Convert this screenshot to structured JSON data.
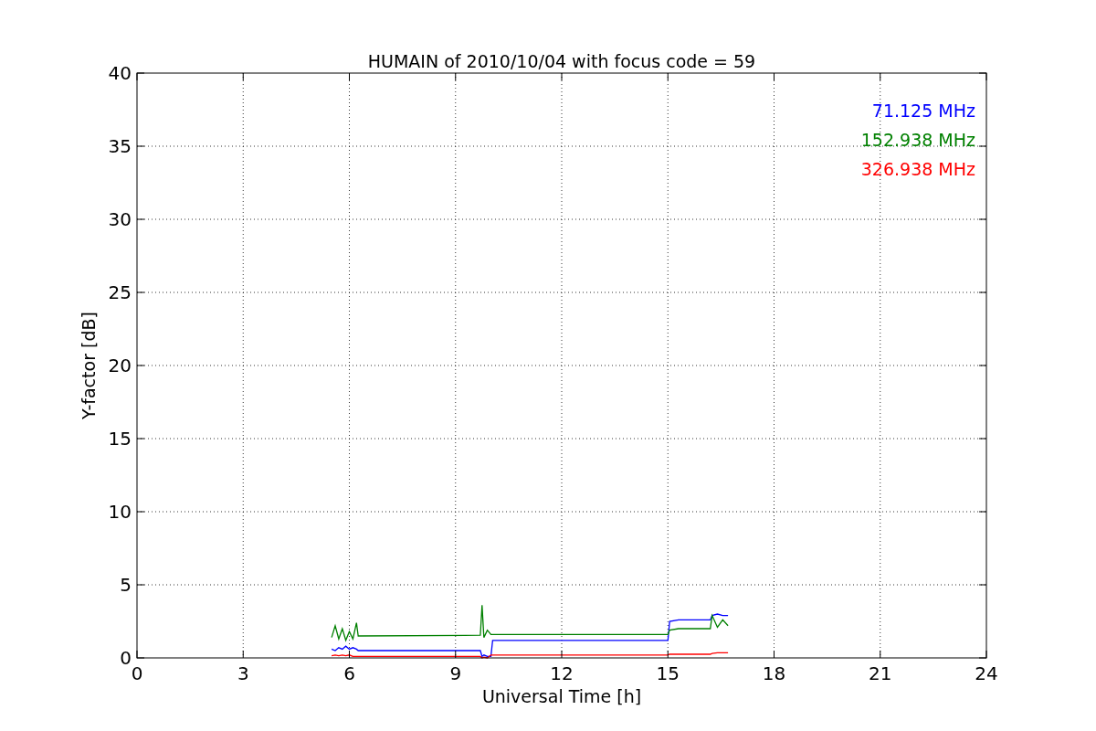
{
  "chart_data": {
    "type": "line",
    "title": "HUMAIN of 2010/10/04 with focus code = 59",
    "xlabel": "Universal Time [h]",
    "ylabel": "Y-factor [dB]",
    "x": [
      5.5,
      5.6,
      5.7,
      5.8,
      5.9,
      6.0,
      6.1,
      6.2,
      6.25,
      9.7,
      9.75,
      9.8,
      9.9,
      10.0,
      10.05,
      15.0,
      15.05,
      15.3,
      16.2,
      16.25,
      16.4,
      16.55,
      16.7
    ],
    "series": [
      {
        "name": "71.125 MHz",
        "color": "#0000ff",
        "values": [
          0.6,
          0.5,
          0.7,
          0.6,
          0.8,
          0.6,
          0.7,
          0.6,
          0.5,
          0.5,
          0.1,
          0.2,
          0.1,
          0.1,
          1.2,
          1.2,
          2.5,
          2.6,
          2.6,
          2.9,
          3.0,
          2.9,
          2.9
        ]
      },
      {
        "name": "152.938 MHz",
        "color": "#008000",
        "values": [
          1.4,
          2.2,
          1.3,
          2.0,
          1.2,
          1.8,
          1.3,
          2.4,
          1.5,
          1.55,
          3.6,
          1.4,
          1.9,
          1.6,
          1.6,
          1.6,
          1.9,
          2.0,
          2.0,
          2.9,
          2.1,
          2.6,
          2.2
        ]
      },
      {
        "name": "326.938 MHz",
        "color": "#ff0000",
        "values": [
          0.15,
          0.2,
          0.15,
          0.2,
          0.15,
          0.2,
          0.1,
          0.1,
          0.1,
          0.1,
          0.0,
          0.05,
          0.0,
          0.2,
          0.2,
          0.2,
          0.25,
          0.25,
          0.25,
          0.3,
          0.35,
          0.35,
          0.35
        ]
      }
    ],
    "grid": true,
    "xlim": [
      0,
      24
    ],
    "ylim": [
      0,
      40
    ],
    "xticks": [
      0,
      3,
      6,
      9,
      12,
      15,
      18,
      21,
      24
    ],
    "yticks": [
      0,
      5,
      10,
      15,
      20,
      25,
      30,
      35,
      40
    ]
  }
}
